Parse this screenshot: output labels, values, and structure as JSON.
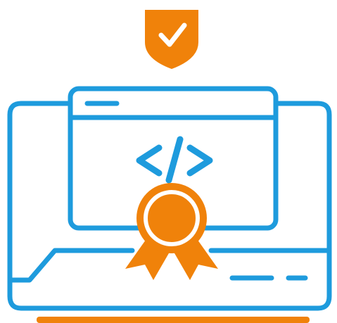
{
  "illustration": {
    "icons": [
      "shield-check-icon",
      "laptop-icon",
      "browser-window-icon",
      "code-brackets-icon",
      "award-ribbon-icon"
    ]
  },
  "colors": {
    "blue": "#1E9BDD",
    "orange": "#F0820A",
    "white": "#FFFFFF"
  }
}
